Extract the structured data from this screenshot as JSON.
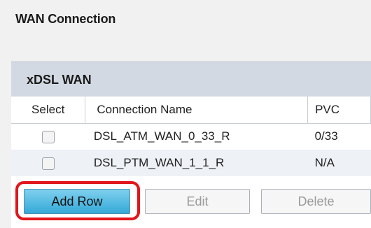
{
  "page": {
    "title": "WAN Connection"
  },
  "panel": {
    "title": "xDSL WAN"
  },
  "table": {
    "columns": [
      "Select",
      "Connection Name",
      "PVC"
    ],
    "rows": [
      {
        "selected": false,
        "name": "DSL_ATM_WAN_0_33_R",
        "pvc": "0/33"
      },
      {
        "selected": false,
        "name": "DSL_PTM_WAN_1_1_R",
        "pvc": "N/A"
      }
    ]
  },
  "buttons": {
    "add_row": "Add Row",
    "edit": "Edit",
    "delete": "Delete"
  },
  "colors": {
    "accent": "#34a9d8",
    "highlight": "#e1161b",
    "header_bg": "#d2d9e3"
  }
}
